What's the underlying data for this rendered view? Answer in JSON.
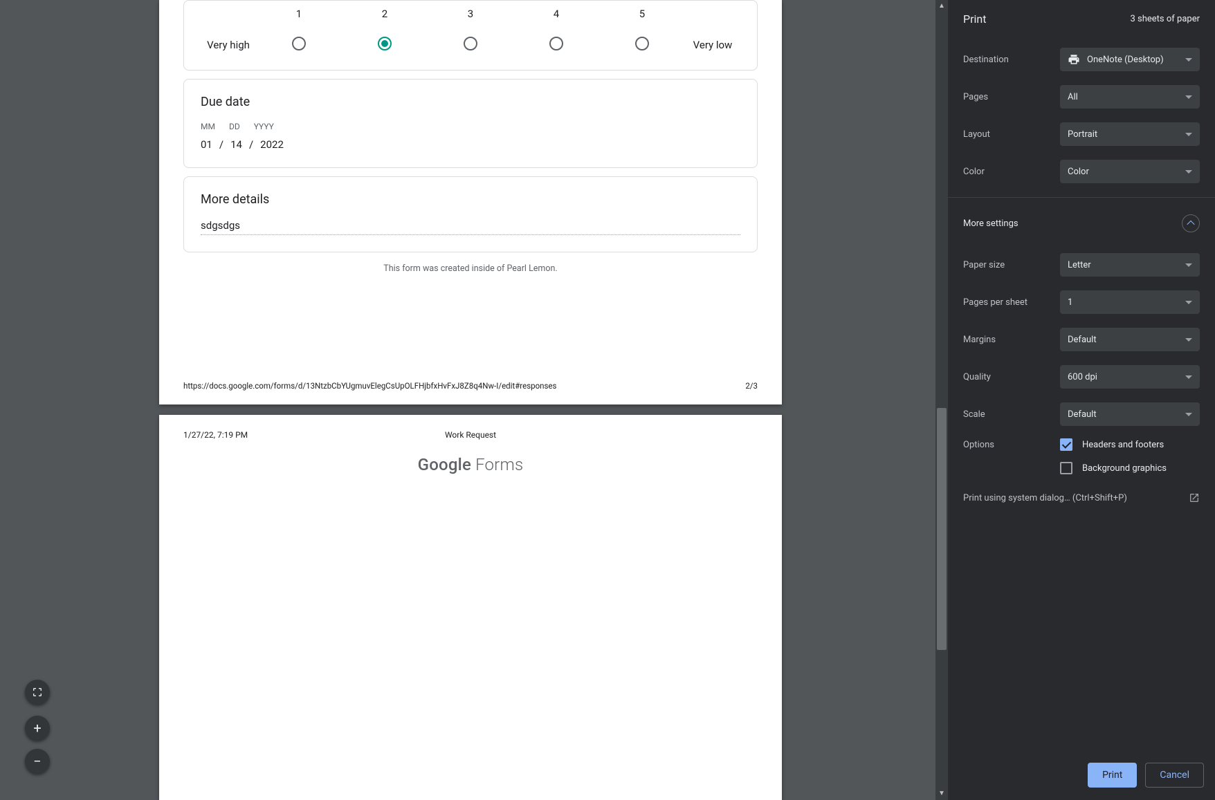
{
  "preview": {
    "page2": {
      "scale": {
        "nums": [
          "1",
          "2",
          "3",
          "4",
          "5"
        ],
        "left_label": "Very high",
        "right_label": "Very low",
        "selected_index": 1
      },
      "due_date": {
        "title": "Due date",
        "mm_label": "MM",
        "dd_label": "DD",
        "yyyy_label": "YYYY",
        "mm": "01",
        "dd": "14",
        "yyyy": "2022",
        "sep": "/"
      },
      "more_details": {
        "title": "More details",
        "value": "sdgsdgs"
      },
      "footnote": "This form was created inside of Pearl Lemon.",
      "footer_url": "https://docs.google.com/forms/d/13NtzbCbYUgmuvElegCsUpOLFHjbfxHvFxJ8Z8q4Nw-I/edit#responses",
      "footer_page": "2/3"
    },
    "page3": {
      "header_time": "1/27/22, 7:19 PM",
      "header_title": "Work Request",
      "logo_a": "Google",
      "logo_b": " Forms"
    }
  },
  "sidebar": {
    "title": "Print",
    "sheet_count": "3 sheets of paper",
    "rows": {
      "destination": {
        "label": "Destination",
        "value": "OneNote (Desktop)"
      },
      "pages": {
        "label": "Pages",
        "value": "All"
      },
      "layout": {
        "label": "Layout",
        "value": "Portrait"
      },
      "color": {
        "label": "Color",
        "value": "Color"
      }
    },
    "more_label": "More settings",
    "more": {
      "paper": {
        "label": "Paper size",
        "value": "Letter"
      },
      "pps": {
        "label": "Pages per sheet",
        "value": "1"
      },
      "margins": {
        "label": "Margins",
        "value": "Default"
      },
      "quality": {
        "label": "Quality",
        "value": "600 dpi"
      },
      "scale": {
        "label": "Scale",
        "value": "Default"
      }
    },
    "options_label": "Options",
    "opt_headers": "Headers and footers",
    "opt_bg": "Background graphics",
    "system_dialog": "Print using system dialog… (Ctrl+Shift+P)",
    "print_btn": "Print",
    "cancel_btn": "Cancel"
  }
}
